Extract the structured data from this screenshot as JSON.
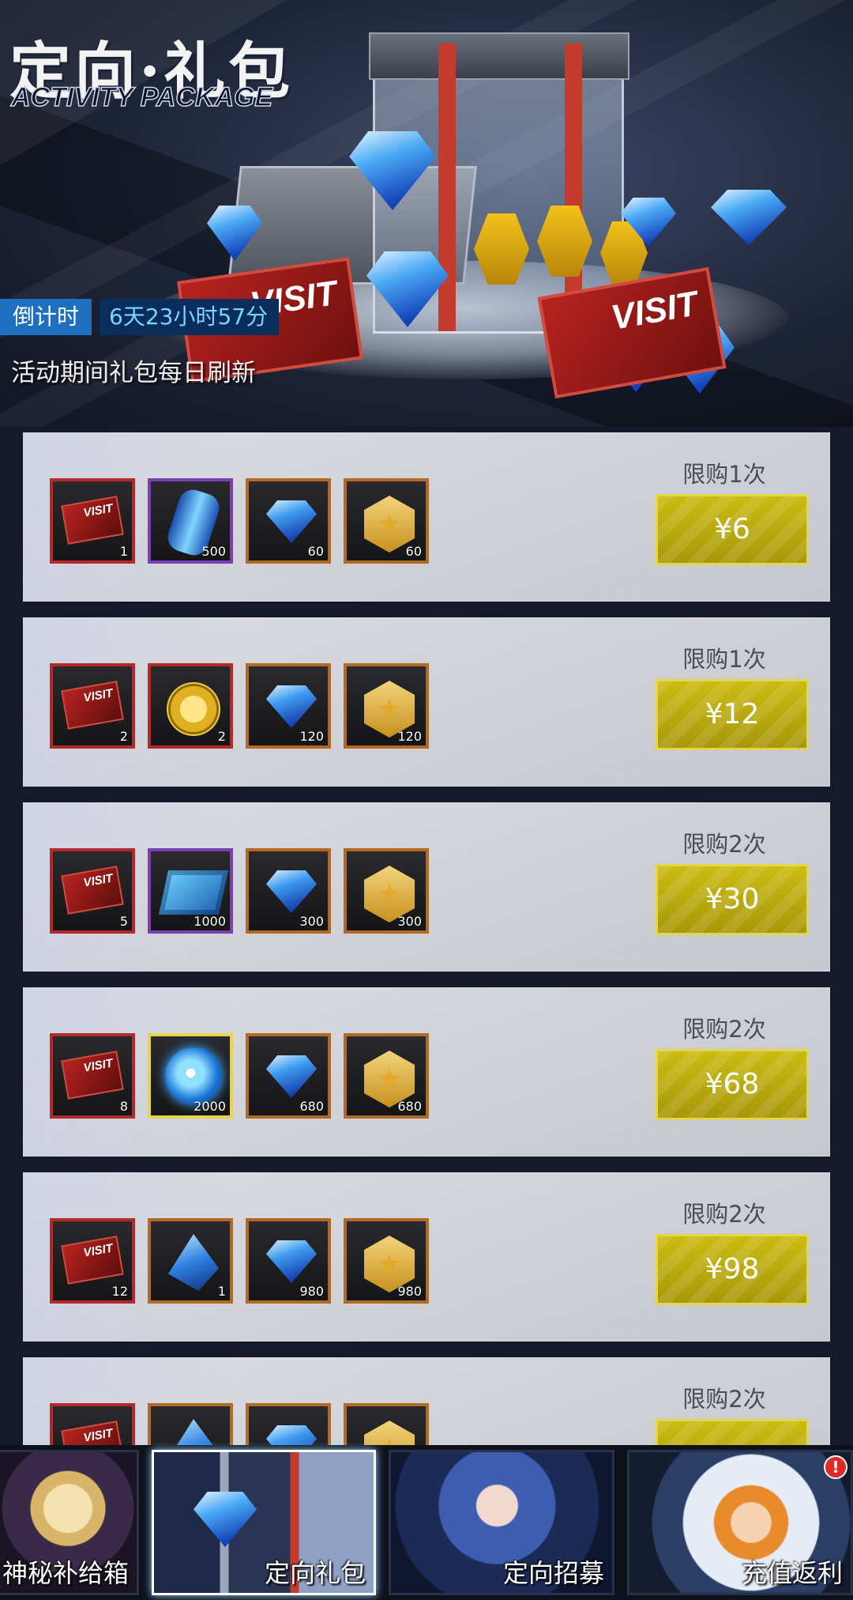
{
  "banner": {
    "title_cn": "定向·礼包",
    "title_en": "ACTIVITY PACKAGE",
    "countdown_label": "倒计时",
    "countdown_value": "6天23小时57分",
    "refresh_note": "活动期间礼包每日刷新",
    "art_text": [
      "VISIT",
      "VISIT"
    ]
  },
  "packages": [
    {
      "limit": "限购1次",
      "price": "¥6",
      "items": [
        {
          "icon": "visit-ticket-icon",
          "qty": "1"
        },
        {
          "icon": "energy-canister-icon",
          "qty": "500"
        },
        {
          "icon": "diamond-icon",
          "qty": "60"
        },
        {
          "icon": "gold-hex-coin-icon",
          "qty": "60"
        }
      ]
    },
    {
      "limit": "限购1次",
      "price": "¥12",
      "items": [
        {
          "icon": "visit-ticket-icon",
          "qty": "2"
        },
        {
          "icon": "gold-coin-icon",
          "qty": "2"
        },
        {
          "icon": "diamond-icon",
          "qty": "120"
        },
        {
          "icon": "gold-hex-coin-icon",
          "qty": "120"
        }
      ]
    },
    {
      "limit": "限购2次",
      "price": "¥30",
      "items": [
        {
          "icon": "visit-ticket-icon",
          "qty": "5"
        },
        {
          "icon": "data-chip-icon",
          "qty": "1000"
        },
        {
          "icon": "diamond-icon",
          "qty": "300"
        },
        {
          "icon": "gold-hex-coin-icon",
          "qty": "300"
        }
      ]
    },
    {
      "limit": "限购2次",
      "price": "¥68",
      "items": [
        {
          "icon": "visit-ticket-icon",
          "qty": "8"
        },
        {
          "icon": "energy-orb-icon",
          "qty": "2000"
        },
        {
          "icon": "diamond-icon",
          "qty": "680"
        },
        {
          "icon": "gold-hex-coin-icon",
          "qty": "680"
        }
      ]
    },
    {
      "limit": "限购2次",
      "price": "¥98",
      "items": [
        {
          "icon": "visit-ticket-icon",
          "qty": "12"
        },
        {
          "icon": "crystal-shard-icon",
          "qty": "1"
        },
        {
          "icon": "diamond-icon",
          "qty": "980"
        },
        {
          "icon": "gold-hex-coin-icon",
          "qty": "980"
        }
      ]
    },
    {
      "limit": "限购2次",
      "price": "",
      "items": [
        {
          "icon": "visit-ticket-icon",
          "qty": ""
        },
        {
          "icon": "crystal-shard-icon",
          "qty": ""
        },
        {
          "icon": "diamond-icon",
          "qty": ""
        },
        {
          "icon": "gold-hex-coin-icon",
          "qty": ""
        }
      ]
    }
  ],
  "tabs": [
    {
      "label": "神秘补给箱",
      "active": false
    },
    {
      "label": "定向礼包",
      "active": true
    },
    {
      "label": "定向招募",
      "active": false
    },
    {
      "label": "充值返利",
      "active": false,
      "badge": "!"
    }
  ],
  "colors": {
    "price_button": "#c2b20f",
    "countdown_label_bg": "#1e6fc0",
    "countdown_value_bg": "#0a2d5c",
    "visit_red": "#b8231f"
  }
}
